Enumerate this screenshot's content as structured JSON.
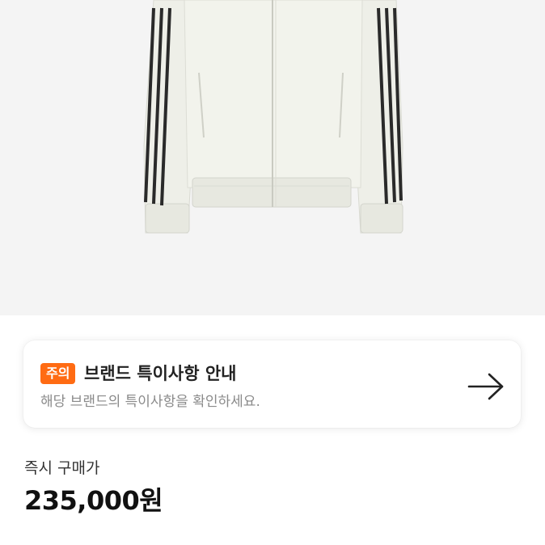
{
  "product": {
    "image_icon": "jacket-image",
    "image_colors": {
      "body": "#f0f1ea",
      "stripe": "#2a2a2a",
      "background": "#f4f4f4"
    }
  },
  "notice": {
    "badge": "주의",
    "title": "브랜드 특이사항 안내",
    "subtitle": "해당 브랜드의 특이사항을 확인하세요.",
    "arrow_icon": "arrow-right-icon",
    "badge_color": "#ff6b13"
  },
  "price": {
    "label": "즉시 구매가",
    "value": "235,000원"
  }
}
